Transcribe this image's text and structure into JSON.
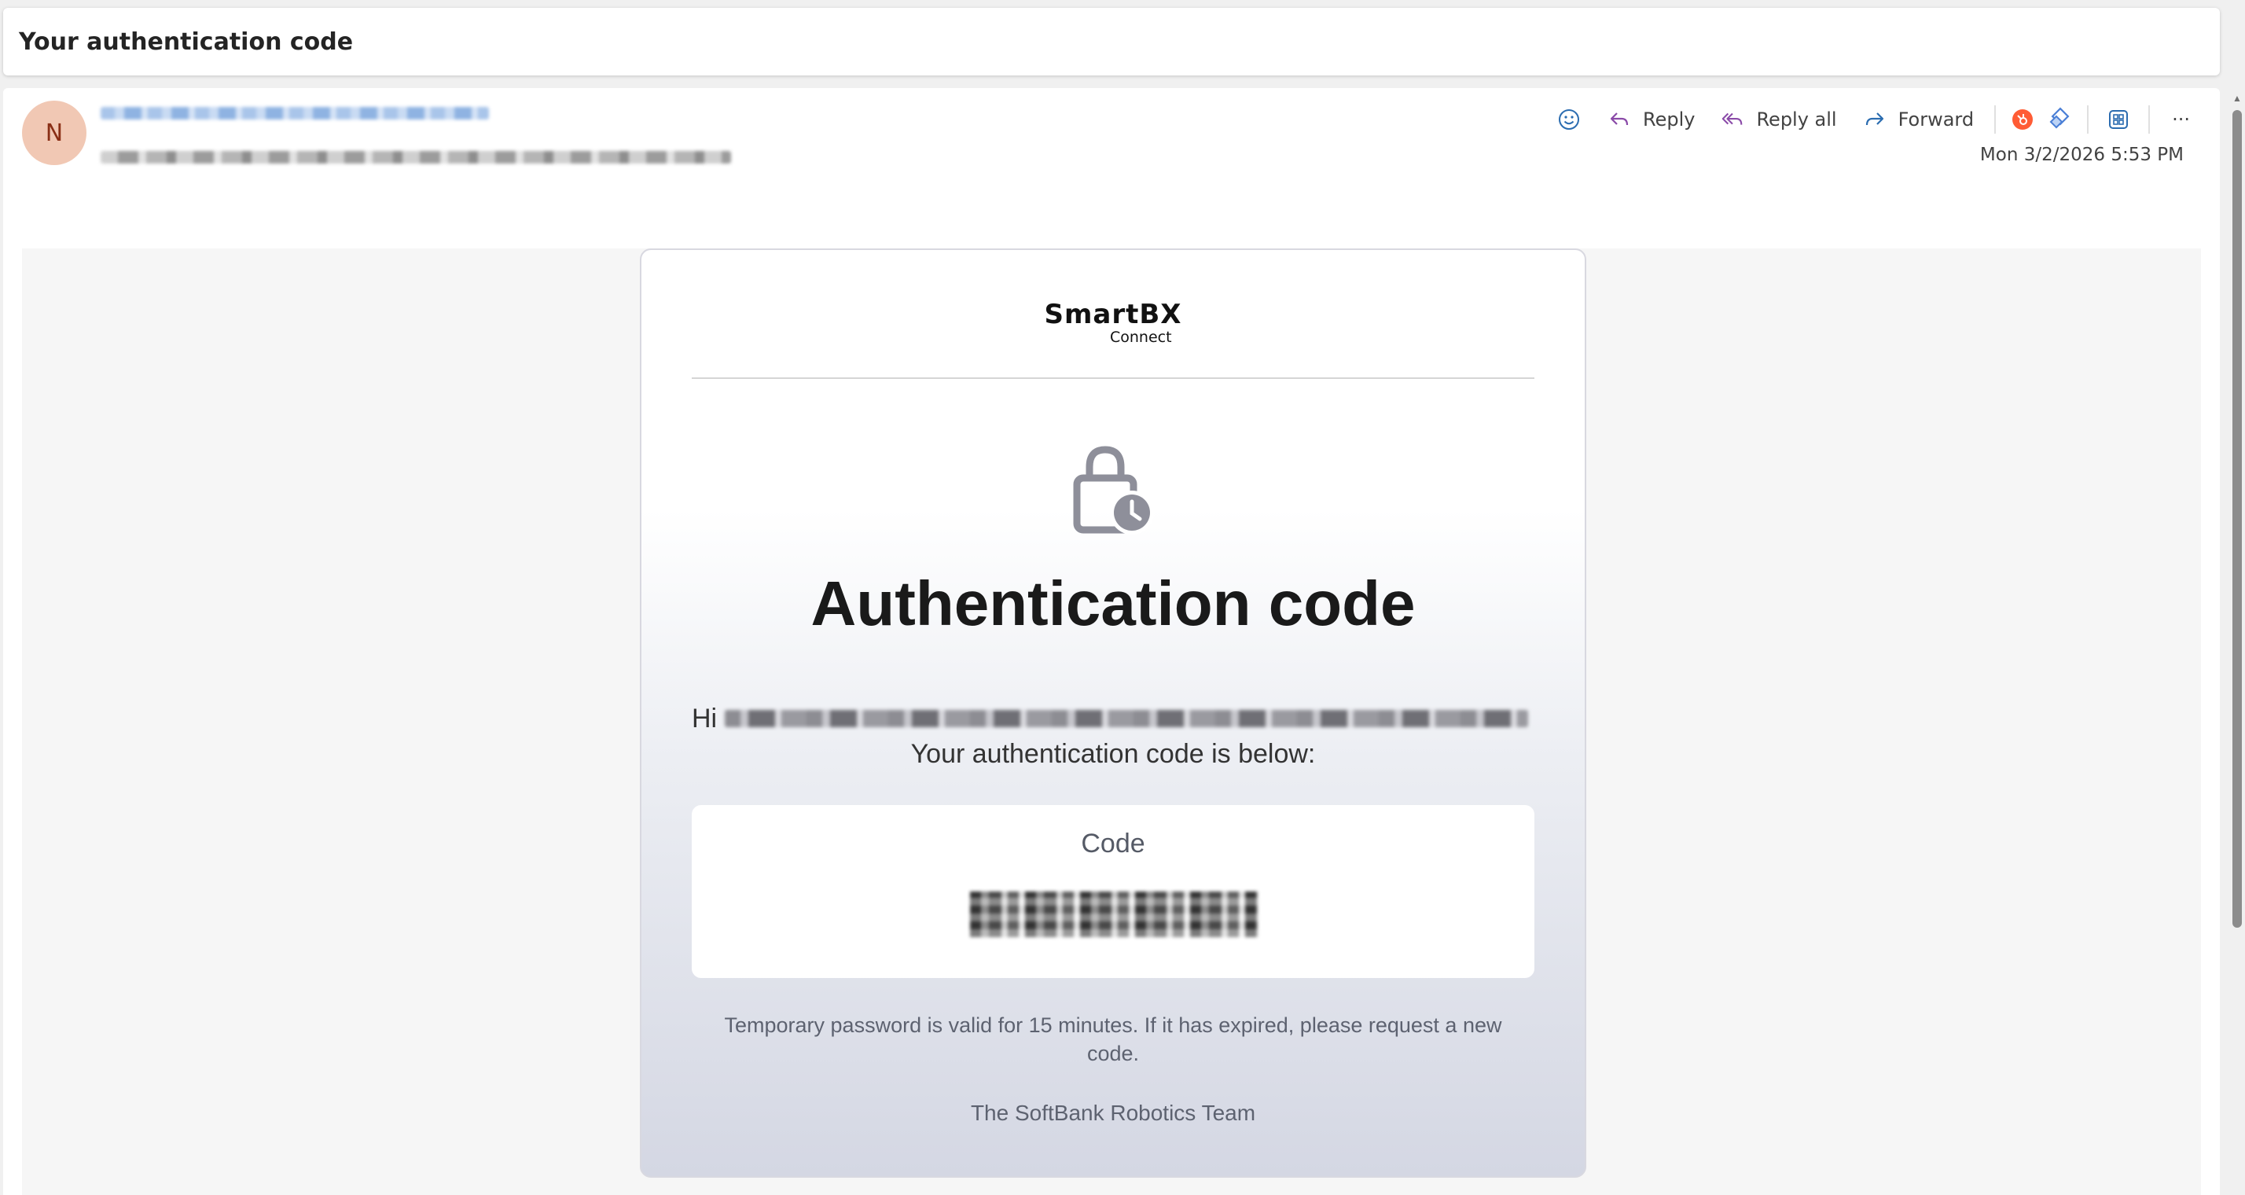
{
  "subject": "Your authentication code",
  "sender": {
    "avatar_initial": "N"
  },
  "toolbar": {
    "react_icon": "smiley-icon",
    "reply_label": "Reply",
    "reply_all_label": "Reply all",
    "forward_label": "Forward",
    "more_label": "···"
  },
  "timestamp": "Mon 3/2/2026 5:53 PM",
  "email": {
    "logo_main": "SmartBX",
    "logo_sub": "Connect",
    "headline": "Authentication code",
    "greeting": "Hi",
    "intro": "Your authentication code is below:",
    "code_label": "Code",
    "note": "Temporary password is valid for 15 minutes. If it has expired, please request a new code.",
    "team": "The SoftBank Robotics Team"
  },
  "colors": {
    "avatar_bg": "#f1c8b4",
    "avatar_text": "#8a2f16",
    "reply_all_accent": "#8a4aa8",
    "hubspot_orange": "#ff5c35",
    "teams_blue": "#4a7fd6"
  }
}
